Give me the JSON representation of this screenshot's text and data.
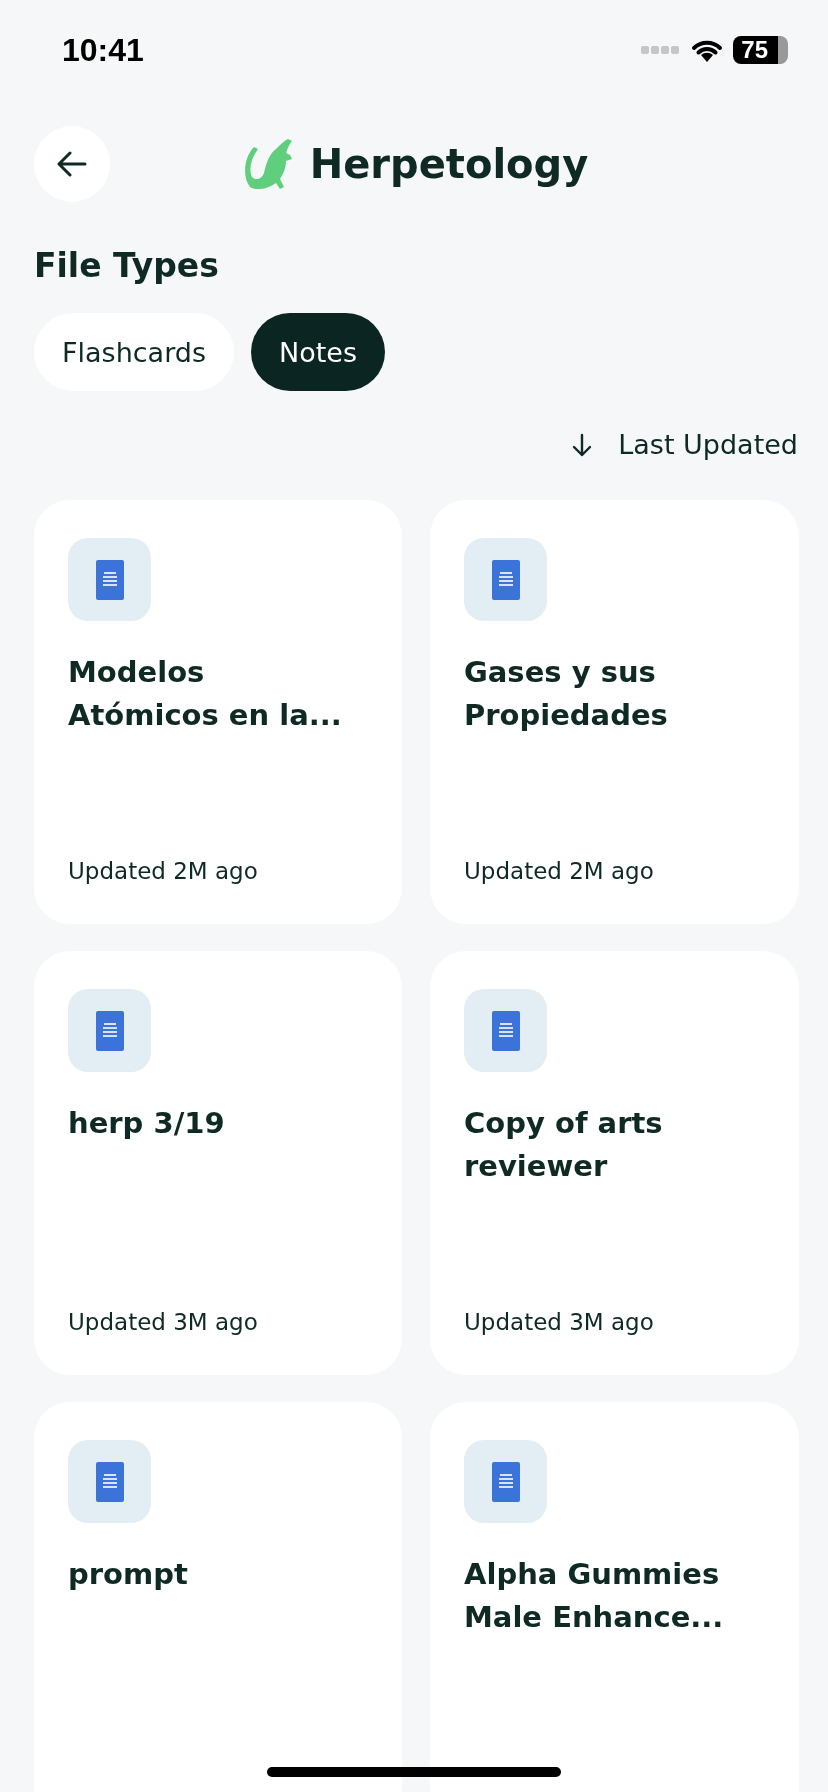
{
  "status_bar": {
    "time": "10:41",
    "battery": "75"
  },
  "header": {
    "title": "Herpetology"
  },
  "section_title": "File Types",
  "filters": [
    {
      "label": "Flashcards",
      "selected": false
    },
    {
      "label": "Notes",
      "selected": true
    }
  ],
  "sort": {
    "label": "Last Updated"
  },
  "notes": [
    {
      "title": "Modelos\nAtómicos en la...",
      "updated": "Updated 2M ago"
    },
    {
      "title": "Gases y sus\nPropiedades",
      "updated": "Updated 2M ago"
    },
    {
      "title": "herp 3/19",
      "updated": "Updated 3M ago"
    },
    {
      "title": "Copy of arts\nreviewer",
      "updated": "Updated 3M ago"
    },
    {
      "title": "prompt"
    },
    {
      "title": "Alpha Gummies\nMale Enhance..."
    }
  ]
}
